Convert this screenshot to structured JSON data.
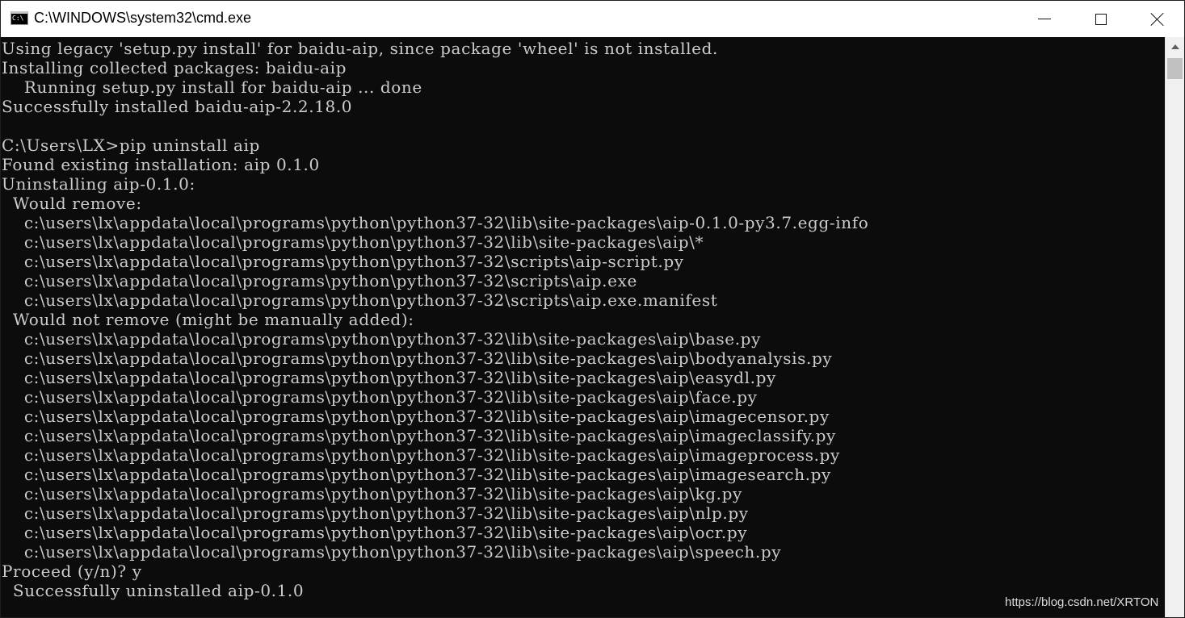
{
  "window": {
    "title": "C:\\WINDOWS\\system32\\cmd.exe",
    "icon_glyph": "C:\\"
  },
  "console": {
    "lines": [
      "Using legacy 'setup.py install' for baidu-aip, since package 'wheel' is not installed.",
      "Installing collected packages: baidu-aip",
      "    Running setup.py install for baidu-aip ... done",
      "Successfully installed baidu-aip-2.2.18.0",
      "",
      "C:\\Users\\LX>pip uninstall aip",
      "Found existing installation: aip 0.1.0",
      "Uninstalling aip-0.1.0:",
      "  Would remove:",
      "    c:\\users\\lx\\appdata\\local\\programs\\python\\python37-32\\lib\\site-packages\\aip-0.1.0-py3.7.egg-info",
      "    c:\\users\\lx\\appdata\\local\\programs\\python\\python37-32\\lib\\site-packages\\aip\\*",
      "    c:\\users\\lx\\appdata\\local\\programs\\python\\python37-32\\scripts\\aip-script.py",
      "    c:\\users\\lx\\appdata\\local\\programs\\python\\python37-32\\scripts\\aip.exe",
      "    c:\\users\\lx\\appdata\\local\\programs\\python\\python37-32\\scripts\\aip.exe.manifest",
      "  Would not remove (might be manually added):",
      "    c:\\users\\lx\\appdata\\local\\programs\\python\\python37-32\\lib\\site-packages\\aip\\base.py",
      "    c:\\users\\lx\\appdata\\local\\programs\\python\\python37-32\\lib\\site-packages\\aip\\bodyanalysis.py",
      "    c:\\users\\lx\\appdata\\local\\programs\\python\\python37-32\\lib\\site-packages\\aip\\easydl.py",
      "    c:\\users\\lx\\appdata\\local\\programs\\python\\python37-32\\lib\\site-packages\\aip\\face.py",
      "    c:\\users\\lx\\appdata\\local\\programs\\python\\python37-32\\lib\\site-packages\\aip\\imagecensor.py",
      "    c:\\users\\lx\\appdata\\local\\programs\\python\\python37-32\\lib\\site-packages\\aip\\imageclassify.py",
      "    c:\\users\\lx\\appdata\\local\\programs\\python\\python37-32\\lib\\site-packages\\aip\\imageprocess.py",
      "    c:\\users\\lx\\appdata\\local\\programs\\python\\python37-32\\lib\\site-packages\\aip\\imagesearch.py",
      "    c:\\users\\lx\\appdata\\local\\programs\\python\\python37-32\\lib\\site-packages\\aip\\kg.py",
      "    c:\\users\\lx\\appdata\\local\\programs\\python\\python37-32\\lib\\site-packages\\aip\\nlp.py",
      "    c:\\users\\lx\\appdata\\local\\programs\\python\\python37-32\\lib\\site-packages\\aip\\ocr.py",
      "    c:\\users\\lx\\appdata\\local\\programs\\python\\python37-32\\lib\\site-packages\\aip\\speech.py",
      "Proceed (y/n)? y",
      "  Successfully uninstalled aip-0.1.0"
    ]
  },
  "watermark": "https://blog.csdn.net/XRTON",
  "icons": {
    "app": "cmd-icon",
    "minimize": "minimize-icon",
    "maximize": "maximize-icon",
    "close": "close-icon",
    "scroll_up": "scroll-up-arrow-icon"
  },
  "colors": {
    "console_bg": "#0c0c0c",
    "console_text": "#cccccc",
    "titlebar_bg": "#ffffff",
    "scrollbar_bg": "#f0f0f0",
    "scroll_thumb": "#c1c1c1"
  }
}
